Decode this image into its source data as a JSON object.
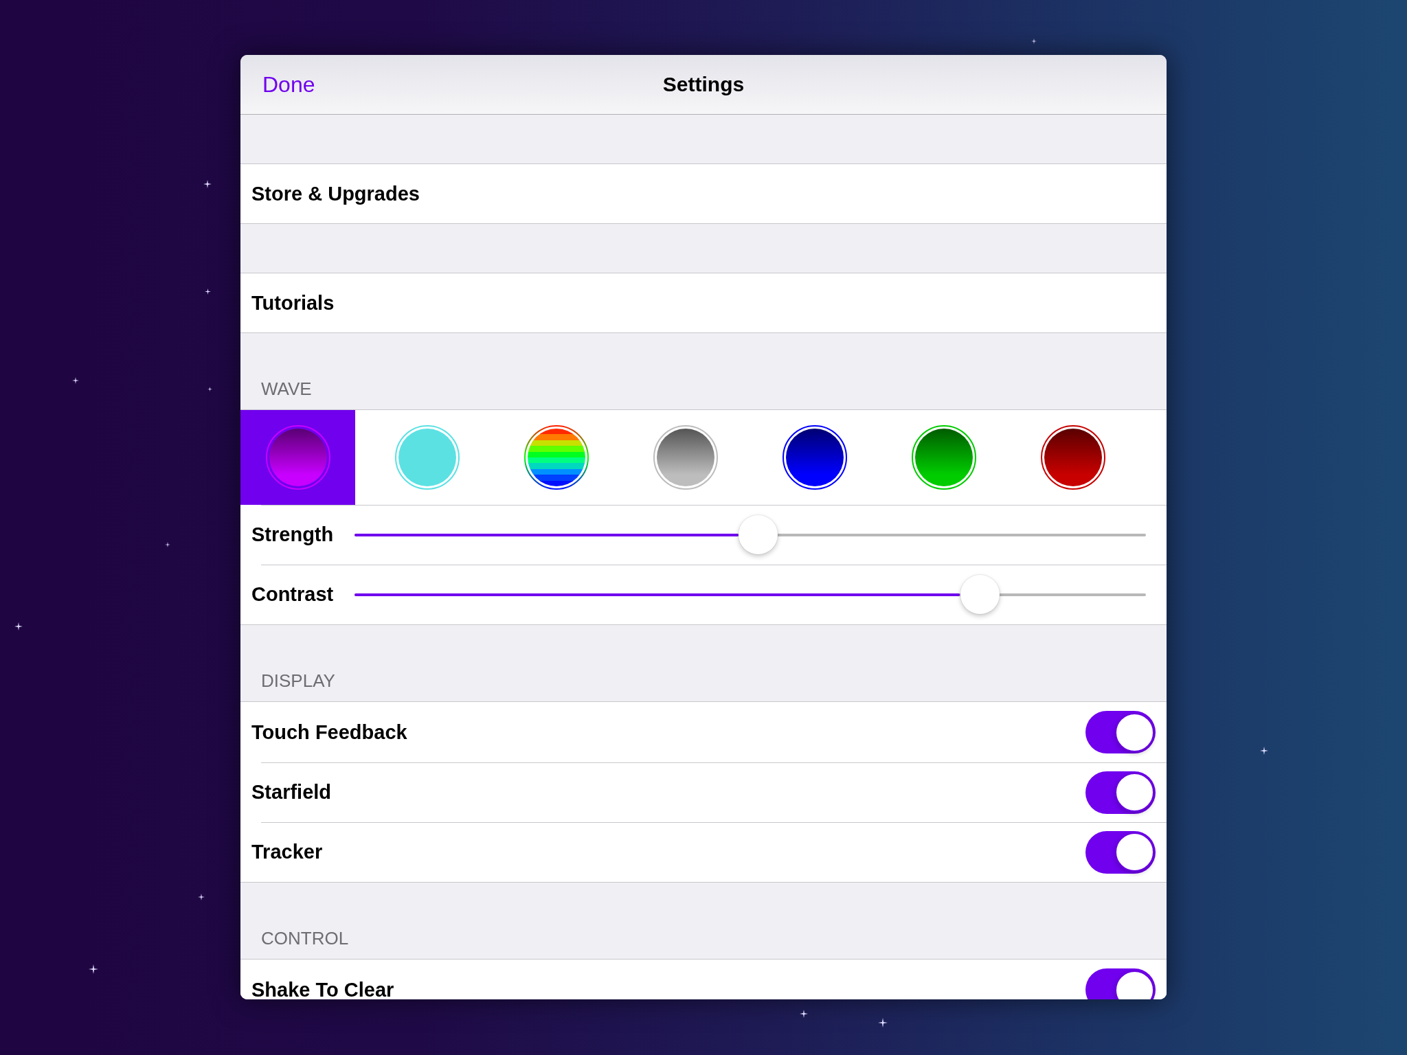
{
  "header": {
    "done": "Done",
    "title": "Settings"
  },
  "groups": [
    {
      "rows": [
        {
          "kind": "link",
          "label": "Store & Upgrades"
        }
      ]
    },
    {
      "rows": [
        {
          "kind": "link",
          "label": "Tutorials"
        }
      ]
    },
    {
      "title": "WAVE",
      "rows": [
        {
          "kind": "swatches",
          "swatches": [
            {
              "kind": "gradient",
              "color": "#c800ff",
              "selected": true
            },
            {
              "kind": "solid",
              "color": "#5ce1e3",
              "selected": false
            },
            {
              "kind": "rainbow",
              "selected": false
            },
            {
              "kind": "gradient",
              "color": "#bdbdbd",
              "selected": false
            },
            {
              "kind": "gradient",
              "color": "#0000ff",
              "selected": false
            },
            {
              "kind": "gradient",
              "color": "#00cc00",
              "selected": false
            },
            {
              "kind": "gradient",
              "color": "#c80000",
              "selected": false
            }
          ]
        },
        {
          "kind": "slider",
          "label": "Strength",
          "level": 0.51
        },
        {
          "kind": "slider",
          "label": "Contrast",
          "level": 0.79
        }
      ]
    },
    {
      "title": "DISPLAY",
      "rows": [
        {
          "kind": "toggle",
          "label": "Touch Feedback",
          "on": true
        },
        {
          "kind": "toggle",
          "label": "Starfield",
          "on": true
        },
        {
          "kind": "toggle",
          "label": "Tracker",
          "on": true
        }
      ]
    },
    {
      "title": "CONTROL",
      "rows": [
        {
          "kind": "toggle",
          "label": "Shake To Clear",
          "on": true
        }
      ]
    }
  ]
}
